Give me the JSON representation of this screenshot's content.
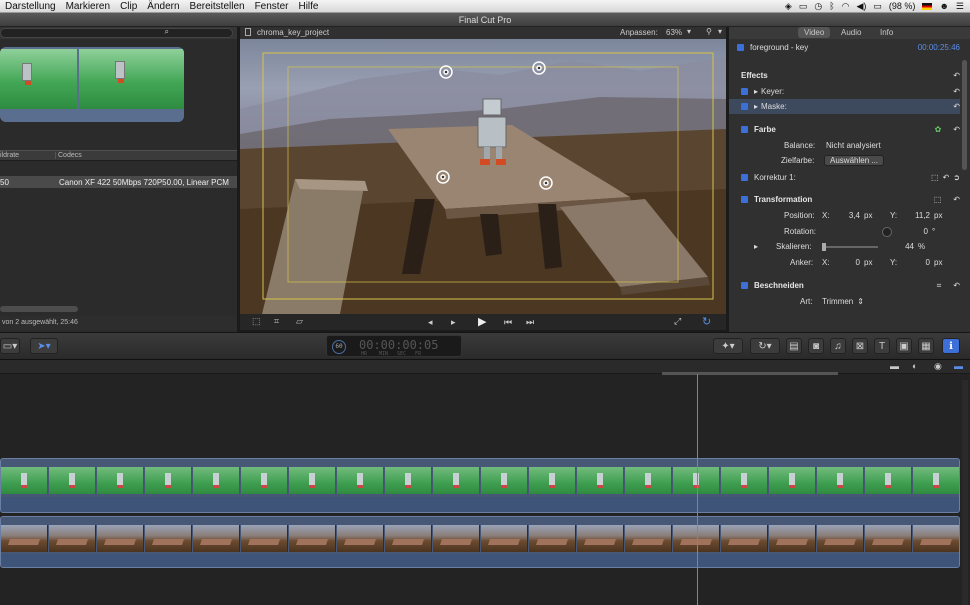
{
  "menubar": {
    "items": [
      "Darstellung",
      "Markieren",
      "Clip",
      "Ändern",
      "Bereitstellen",
      "Fenster",
      "Hilfe"
    ],
    "battery": "(98 %)"
  },
  "window": {
    "title": "Final Cut Pro"
  },
  "browser": {
    "columns": [
      "ildrate",
      "Codecs"
    ],
    "row": {
      "rate": "50",
      "codec": "Canon XF 422 50Mbps 720P50.00, Linear PCM"
    },
    "status": "von 2 ausgewählt, 25:46"
  },
  "viewer": {
    "project": "chroma_key_project",
    "fit_label": "Anpassen:",
    "zoom": "63%"
  },
  "inspector": {
    "tabs": [
      "Video",
      "Audio",
      "Info"
    ],
    "clip_name": "foreground - key",
    "duration": "00:00:25:46",
    "effects_title": "Effects",
    "keyer": "Keyer:",
    "maske": "Maske:",
    "farbe": "Farbe",
    "balance_label": "Balance:",
    "balance_value": "Nicht analysiert",
    "zielfarbe_label": "Zielfarbe:",
    "zielfarbe_button": "Auswählen ...",
    "korrektur": "Korrektur 1:",
    "transformation": "Transformation",
    "position_label": "Position:",
    "position_x_label": "X:",
    "position_x": "3,4",
    "position_x_unit": "px",
    "position_y_label": "Y:",
    "position_y": "11,2",
    "position_y_unit": "px",
    "rotation_label": "Rotation:",
    "rotation_value": "0",
    "rotation_unit": "°",
    "scale_label": "Skalieren:",
    "scale_value": "44",
    "scale_unit": "%",
    "anchor_label": "Anker:",
    "anchor_x_label": "X:",
    "anchor_x": "0",
    "anchor_x_unit": "px",
    "anchor_y_label": "Y:",
    "anchor_y": "0",
    "anchor_y_unit": "px",
    "crop_title": "Beschneiden",
    "crop_type_label": "Art:",
    "crop_type_value": "Trimmen"
  },
  "timecode": {
    "value": "00:00:00:05",
    "fps": "60",
    "units": [
      "HR",
      "MIN",
      "SEC",
      "FR"
    ]
  },
  "colors": {
    "accent": "#3d6fd9",
    "playhead": "#d26a4a",
    "clip_border": "#6a7fa3"
  }
}
